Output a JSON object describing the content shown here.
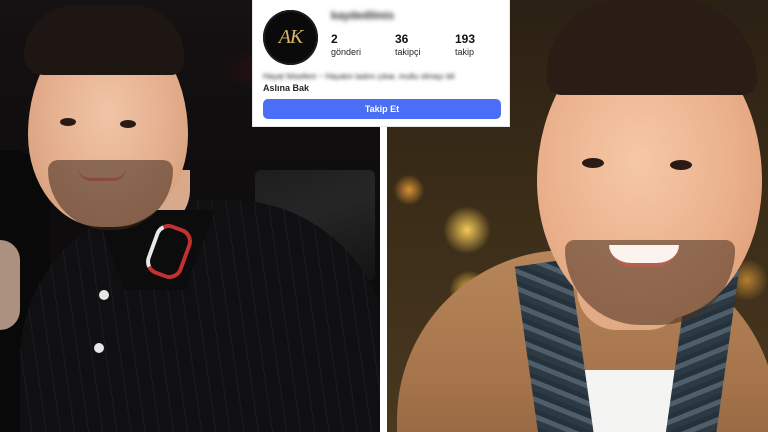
{
  "profile": {
    "username": "kaydedilmis",
    "avatar_text": "AK",
    "stats": {
      "posts": {
        "count": "2",
        "label": "gönderi"
      },
      "followers": {
        "count": "36",
        "label": "takipçi"
      },
      "following": {
        "count": "193",
        "label": "takip"
      }
    },
    "bio": "Hayat felsefem ~ Hayatın tadını çıkar, mutlu olmayı bil",
    "name": "Aslına Bak",
    "follow_button": "Takip Et"
  },
  "colors": {
    "follow_button": "#4a6ef5",
    "avatar_background": "#0a0a0a",
    "avatar_logo": "#d6b46a"
  }
}
